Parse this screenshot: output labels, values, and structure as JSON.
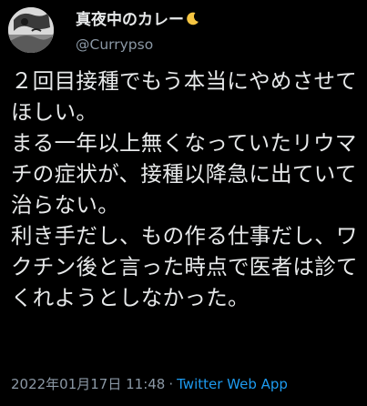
{
  "author": {
    "display_name": "真夜中のカレー",
    "moon_icon": "crescent-moon-icon",
    "handle": "@Currypso"
  },
  "tweet": {
    "text": "２回目接種でもう本当にやめさせてほしい。\nまる一年以上無くなっていたリウマチの症状が、接種以降急に出ていて治らない。\n利き手だし、もの作る仕事だし、ワクチン後と言った時点で医者は診てくれようとしなかった。",
    "timestamp": "2022年01月17日 11:48",
    "separator": "·",
    "source": "Twitter Web App"
  },
  "colors": {
    "background": "#000000",
    "primary_text": "#e7e9ea",
    "secondary_text": "#8b98a5",
    "link": "#1d9bf0",
    "moon": "#f5c542"
  }
}
